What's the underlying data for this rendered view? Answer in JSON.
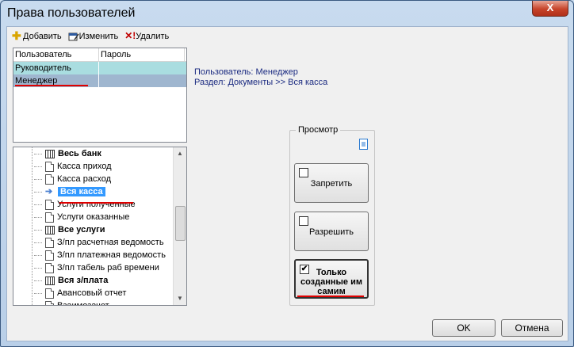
{
  "window": {
    "title": "Права пользователей",
    "close_label": "X"
  },
  "toolbar": {
    "add_label": "Добавить",
    "edit_label": "Изменить",
    "delete_label": "Удалить"
  },
  "users": {
    "columns": [
      "Пользователь",
      "Пароль"
    ],
    "rows": [
      {
        "user": "Руководитель",
        "password": ""
      },
      {
        "user": "Менеджер",
        "password": ""
      }
    ]
  },
  "info": {
    "user_line": "Пользователь:  Менеджер",
    "section_line": "Раздел:  Документы >> Вся касса"
  },
  "tree": {
    "items": [
      {
        "label": "Весь банк",
        "icon": "grid-icon",
        "bold": true
      },
      {
        "label": "Касса приход",
        "icon": "document-icon"
      },
      {
        "label": "Касса расход",
        "icon": "document-icon"
      },
      {
        "label": "Вся касса",
        "icon": "arrow-right-icon",
        "bold": true,
        "selected": true
      },
      {
        "label": "Услуги полученные",
        "icon": "document-icon"
      },
      {
        "label": "Услуги оказанные",
        "icon": "document-icon"
      },
      {
        "label": "Все услуги",
        "icon": "grid-icon",
        "bold": true
      },
      {
        "label": "З/пл расчетная ведомость",
        "icon": "document-icon"
      },
      {
        "label": "З/пл платежная ведомость",
        "icon": "document-icon"
      },
      {
        "label": "З/пл табель раб времени",
        "icon": "document-icon"
      },
      {
        "label": "Вся з/плата",
        "icon": "grid-icon",
        "bold": true
      },
      {
        "label": "Авансовый отчет",
        "icon": "document-icon"
      },
      {
        "label": "Взаимозачет",
        "icon": "document-icon"
      }
    ]
  },
  "view_group": {
    "label": "Просмотр",
    "deny": {
      "label": "Запретить",
      "checked": false
    },
    "allow": {
      "label": "Разрешить",
      "checked": false
    },
    "own_only": {
      "line1": "Только",
      "line2": "созданные им",
      "line3": "самим",
      "checked": true,
      "check_mark": "✔"
    }
  },
  "buttons": {
    "ok": "OK",
    "cancel": "Отмена"
  },
  "colors": {
    "selection": "#3399ff",
    "row_a": "#a9dde0",
    "row_b": "#9fb6cf",
    "annotation_red": "#e00000",
    "info_text": "#1a2a80"
  }
}
